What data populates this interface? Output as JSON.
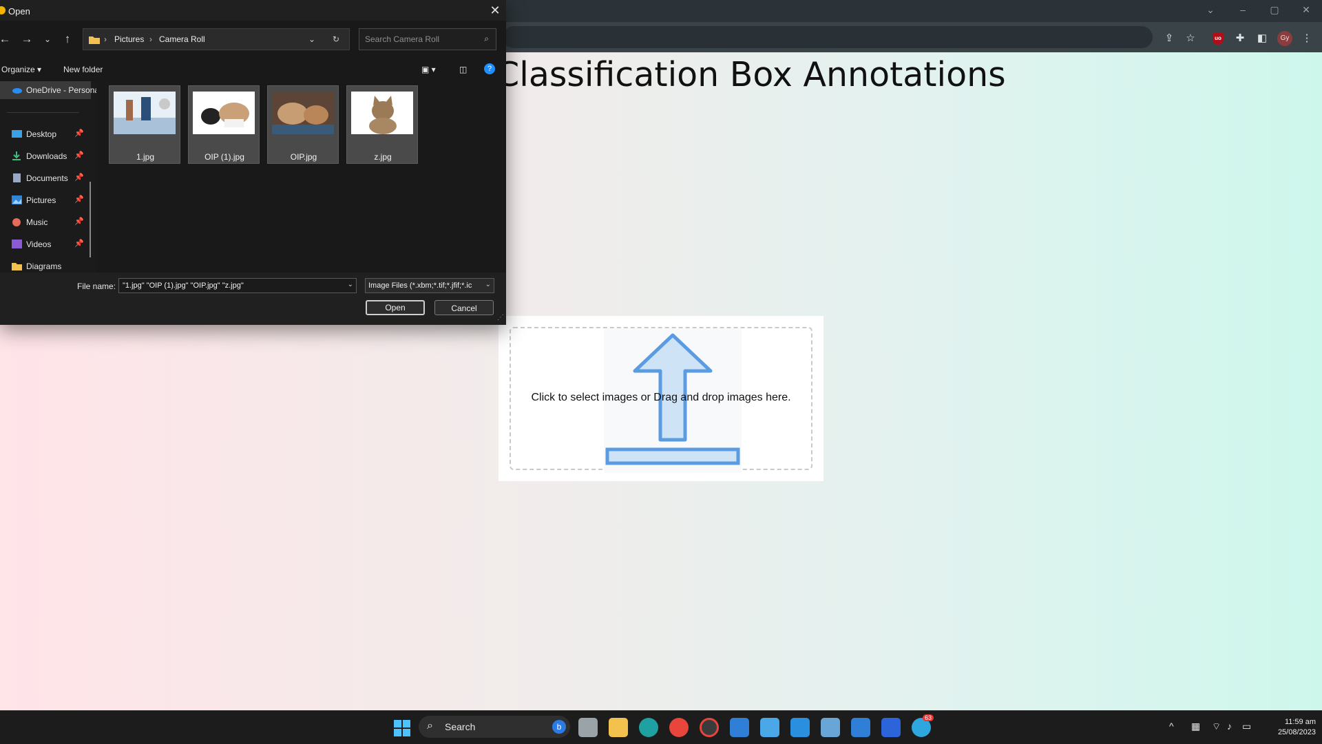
{
  "browser": {
    "win_controls": [
      "⌄",
      "–",
      "▢",
      "✕"
    ],
    "profile_initials": "Gy",
    "ublock_label": "uo"
  },
  "page": {
    "title": "Classification Box Annotations",
    "upload_text": "Click to select images or Drag and drop images here."
  },
  "dialog": {
    "title": "Open",
    "breadcrumb": [
      "Pictures",
      "Camera Roll"
    ],
    "search_placeholder": "Search Camera Roll",
    "organize_label": "Organize",
    "new_folder_label": "New folder",
    "nav_items": [
      {
        "label": "OneDrive - Personal",
        "pinned": false
      },
      {
        "label": "Desktop",
        "pinned": true
      },
      {
        "label": "Downloads",
        "pinned": true
      },
      {
        "label": "Documents",
        "pinned": true
      },
      {
        "label": "Pictures",
        "pinned": true
      },
      {
        "label": "Music",
        "pinned": true
      },
      {
        "label": "Videos",
        "pinned": true
      },
      {
        "label": "Diagrams",
        "pinned": false
      }
    ],
    "files": [
      "1.jpg",
      "OIP (1).jpg",
      "OIP.jpg",
      "z.jpg"
    ],
    "file_name_label": "File name:",
    "file_name_value": "\"1.jpg\" \"OIP (1).jpg\" \"OIP.jpg\" \"z.jpg\"",
    "file_type_value": "Image Files (*.xbm;*.tif;*.jfif;*.ic",
    "open_label": "Open",
    "cancel_label": "Cancel"
  },
  "taskbar": {
    "search_label": "Search",
    "time": "11:59 am",
    "date": "25/08/2023",
    "telegram_badge": "63"
  },
  "colors": {
    "dialog_bg": "#191919",
    "page_gradient_left": "#ffe4e8",
    "page_gradient_right": "#cef7ec",
    "accent_blue": "#0078d4"
  }
}
